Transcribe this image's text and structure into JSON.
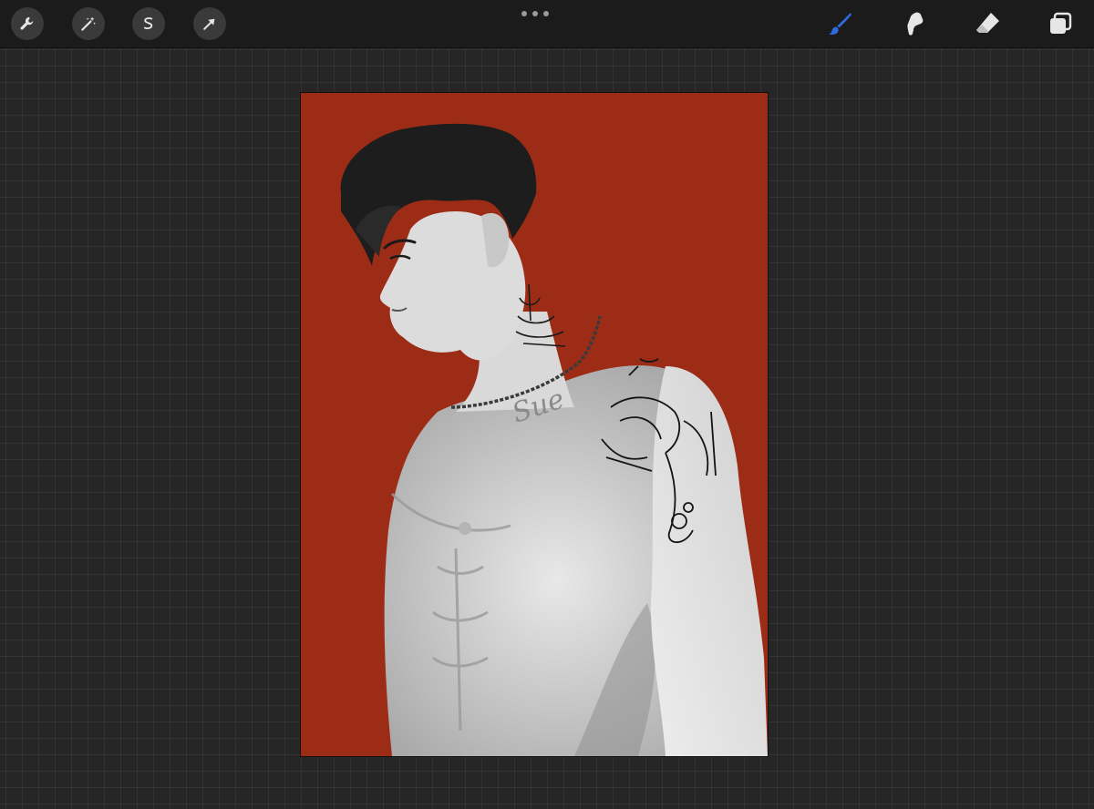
{
  "toolbar": {
    "left_tools": [
      {
        "name": "actions",
        "icon": "wrench-icon"
      },
      {
        "name": "adjustments",
        "icon": "magic-wand-icon"
      },
      {
        "name": "selection",
        "icon": "selection-icon"
      },
      {
        "name": "transform",
        "icon": "arrow-cursor-icon"
      }
    ],
    "more": {
      "icon": "more-dots-icon"
    },
    "right_tools": [
      {
        "name": "brush",
        "icon": "brush-icon",
        "active": true
      },
      {
        "name": "smudge",
        "icon": "smudge-icon"
      },
      {
        "name": "eraser",
        "icon": "eraser-icon"
      },
      {
        "name": "layers",
        "icon": "layers-icon"
      }
    ],
    "active_color": "#2f6bdc",
    "icon_color": "#e6e6e6"
  },
  "canvas": {
    "background_color": "#9c2c16",
    "signature": "Sue"
  }
}
